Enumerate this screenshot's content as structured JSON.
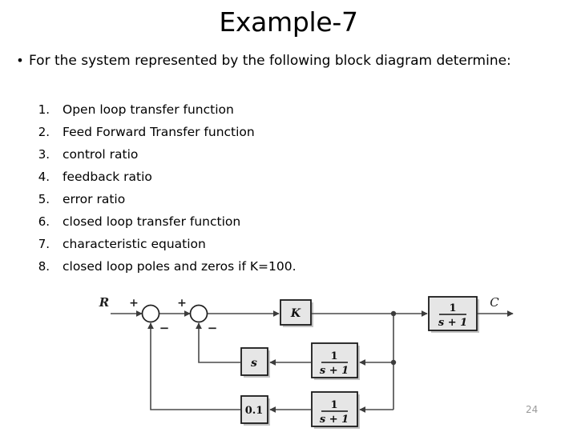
{
  "slide": {
    "title": "Example-7",
    "page_number": "24",
    "background_color": "#ffffff",
    "text_color": "#000000",
    "page_number_color": "#9a9a9a"
  },
  "bullet": {
    "marker": "•",
    "text": "For the system represented by the following block diagram determine:"
  },
  "tasks": [
    {
      "number": "1.",
      "label": "Open loop transfer function"
    },
    {
      "number": "2.",
      "label": "Feed Forward Transfer function"
    },
    {
      "number": "3.",
      "label": "control ratio"
    },
    {
      "number": "4.",
      "label": "feedback ratio"
    },
    {
      "number": "5.",
      "label": "error ratio"
    },
    {
      "number": "6.",
      "label": "closed loop transfer function"
    },
    {
      "number": "7.",
      "label": "characteristic equation"
    },
    {
      "number": "8.",
      "label": "closed loop poles and zeros if K=100."
    }
  ],
  "diagram": {
    "block_fill": "#e6e6e6",
    "block_stroke": "#1a1a1a",
    "line_color": "#4a4a4a",
    "signals": {
      "input_label": "R",
      "output_label": "C"
    },
    "summing_junctions": [
      {
        "name": "sum-1",
        "plus": "+",
        "minus": "−"
      },
      {
        "name": "sum-2",
        "plus": "+",
        "minus": "−"
      }
    ],
    "blocks": [
      {
        "name": "gain-k",
        "label": "K",
        "kind": "plain"
      },
      {
        "name": "forward-lag",
        "numerator": "1",
        "denominator": "s + 1",
        "kind": "fraction"
      },
      {
        "name": "inner-derivative",
        "label": "s",
        "kind": "plain"
      },
      {
        "name": "inner-lag",
        "numerator": "1",
        "denominator": "s + 1",
        "kind": "fraction"
      },
      {
        "name": "outer-gain",
        "label": "0.1",
        "kind": "plain"
      },
      {
        "name": "outer-lag",
        "numerator": "1",
        "denominator": "s + 1",
        "kind": "fraction"
      }
    ]
  }
}
